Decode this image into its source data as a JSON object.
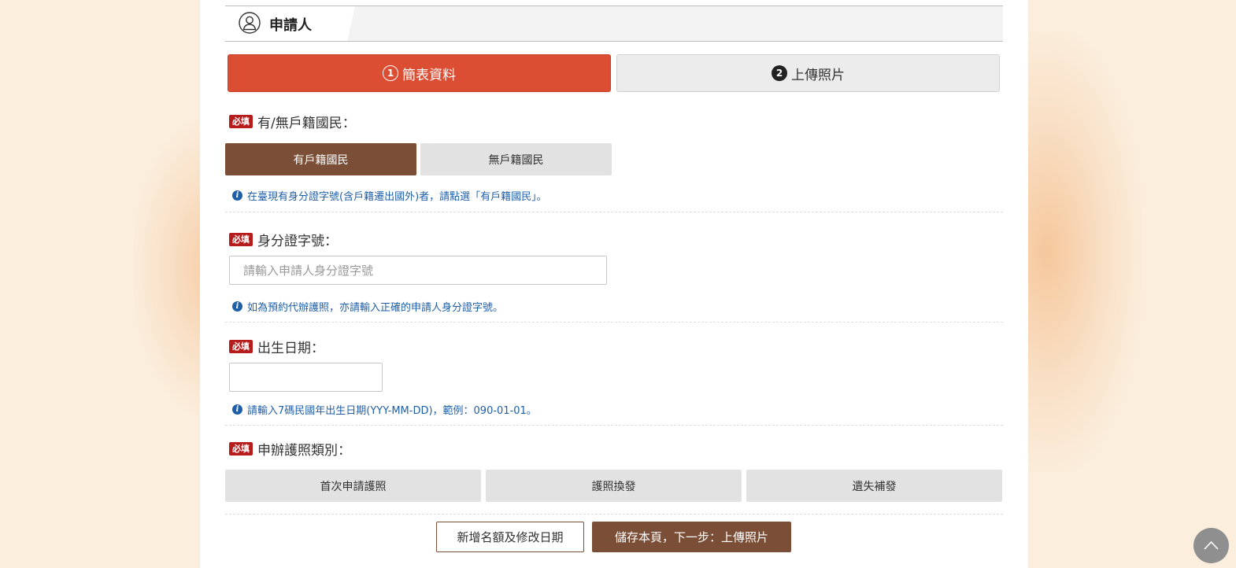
{
  "section": {
    "title": "申請人",
    "icon": "user-icon"
  },
  "steps": [
    {
      "num": "1",
      "label": "簡表資料",
      "active": true
    },
    {
      "num": "2",
      "label": "上傳照片",
      "active": false
    }
  ],
  "required_badge": "必填",
  "citizenship": {
    "label": "有/無戶籍國民：",
    "options": [
      "有戶籍國民",
      "無戶籍國民"
    ],
    "selected": "有戶籍國民",
    "hint": "在臺現有身分證字號(含戶籍遷出國外)者，請點選「有戶籍國民」。"
  },
  "id_number": {
    "label": "身分證字號：",
    "placeholder": "請輸入申請人身分證字號",
    "value": "",
    "hint": "如為預約代辦護照，亦請輸入正確的申請人身分證字號。"
  },
  "birth_date": {
    "label": "出生日期：",
    "value": "",
    "hint": "請輸入7碼民國年出生日期(YYY-MM-DD)，範例：090-01-01。"
  },
  "passport_type": {
    "label": "申辦護照類別：",
    "options": [
      "首次申請護照",
      "護照換發",
      "遺失補發"
    ]
  },
  "buttons": {
    "add": "新增名額及修改日期",
    "save": "儲存本頁，下一步：上傳照片"
  },
  "colors": {
    "accent_red": "#dc4e33",
    "brown": "#7b4f37",
    "required_red": "#b71c1c",
    "hint_blue": "#1f5fa8",
    "page_bg": "#fbeedd"
  }
}
